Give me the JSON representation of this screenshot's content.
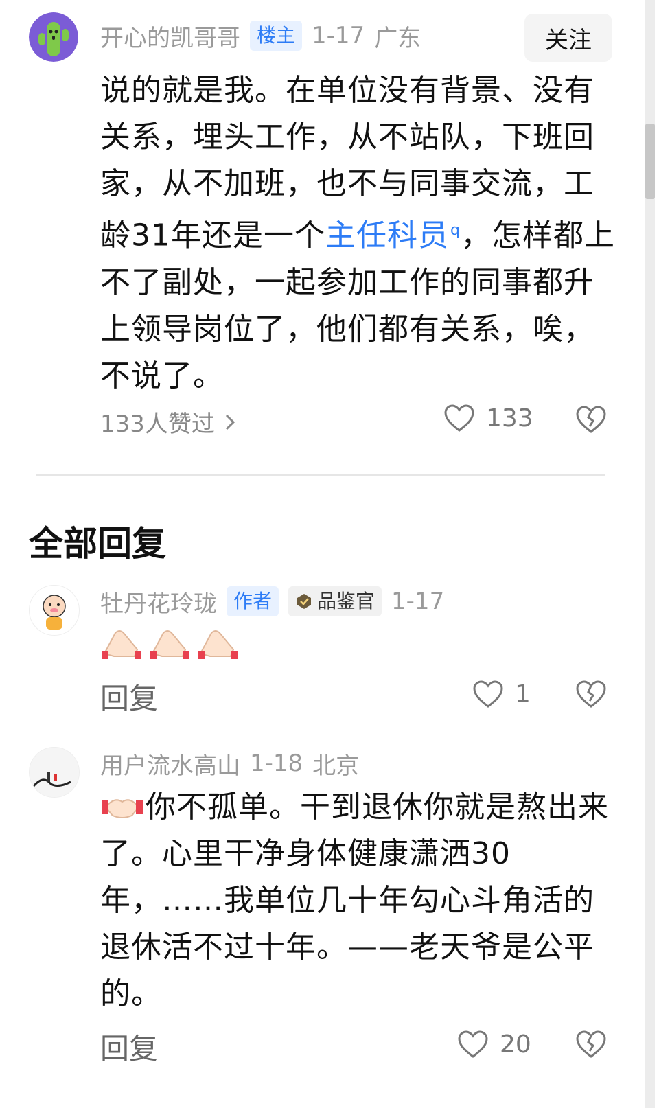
{
  "post": {
    "author": "开心的凯哥哥",
    "role_tag": "楼主",
    "date": "1-17",
    "location": "广东",
    "follow_label": "关注",
    "content_before_link": "说的就是我。在单位没有背景、没有关系，埋头工作，从不站队，下班回家，从不加班，也不与同事交流，工龄31年还是一个",
    "content_link": "主任科员",
    "content_link_marker": "q",
    "content_after_link": "，怎样都上不了副处，一起参加工作的同事都升上领导岗位了，他们都有关系，唉，不说了。",
    "liked_by": "133人赞过",
    "like_count": "133"
  },
  "replies_section": {
    "title": "全部回复",
    "replies": [
      {
        "author": "牡丹花玲珑",
        "author_tag": "作者",
        "badge": "品鉴官",
        "date": "1-17",
        "reply_label": "回复",
        "like_count": "1"
      },
      {
        "author": "用户流水高山",
        "date": "1-18",
        "location": "北京",
        "content": "你不孤单。干到退休你就是熬出来了。心里干净身体健康潇洒30年，……我单位几十年勾心斗角活的退休活不过十年。——老天爷是公平的。",
        "reply_label": "回复",
        "like_count": "20"
      }
    ]
  },
  "colors": {
    "accent": "#2d7cf6",
    "muted": "#9a9a9a",
    "tag_bg": "#e8f1ff"
  }
}
